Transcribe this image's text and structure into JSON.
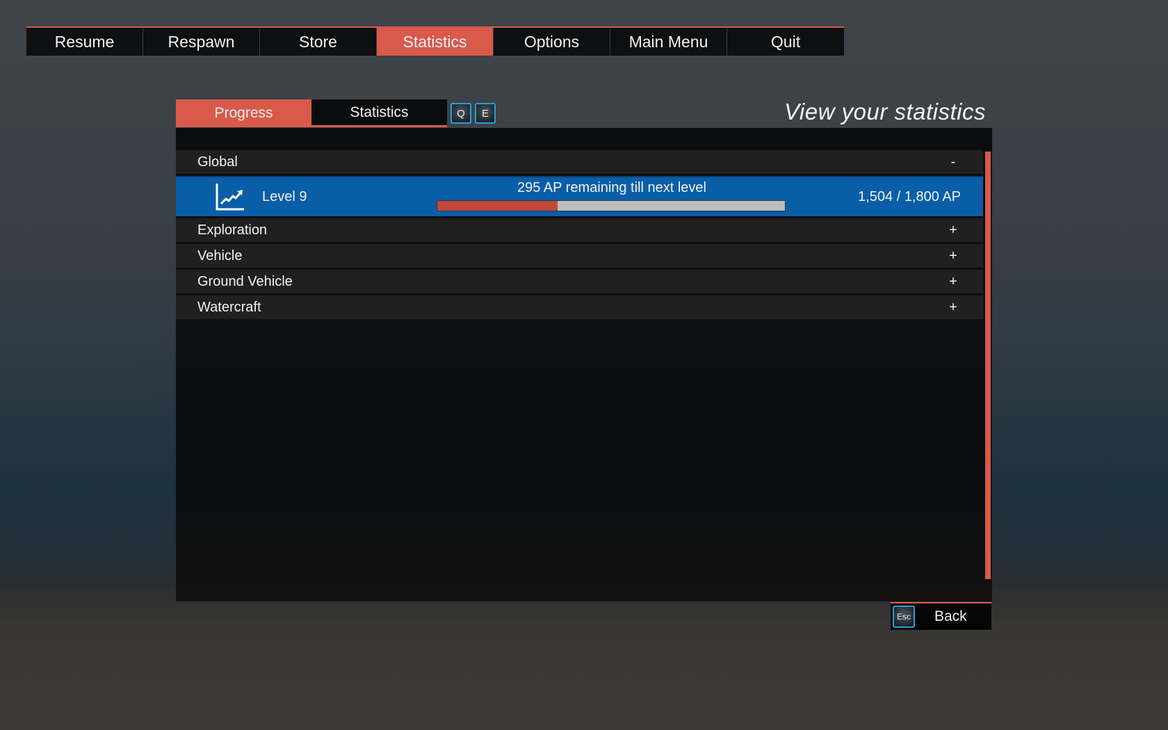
{
  "top_menu": {
    "items": [
      {
        "label": "Resume"
      },
      {
        "label": "Respawn"
      },
      {
        "label": "Store"
      },
      {
        "label": "Statistics",
        "active": true
      },
      {
        "label": "Options"
      },
      {
        "label": "Main Menu"
      },
      {
        "label": "Quit"
      }
    ]
  },
  "sub_tabs": {
    "items": [
      {
        "label": "Progress",
        "active": true
      },
      {
        "label": "Statistics",
        "active": false
      }
    ],
    "prev_key": "Q",
    "next_key": "E"
  },
  "page_heading": "View your statistics",
  "categories": [
    {
      "label": "Global",
      "toggle": "-",
      "expanded": true
    },
    {
      "label": "Exploration",
      "toggle": "+",
      "expanded": false
    },
    {
      "label": "Vehicle",
      "toggle": "+",
      "expanded": false
    },
    {
      "label": "Ground Vehicle",
      "toggle": "+",
      "expanded": false
    },
    {
      "label": "Watercraft",
      "toggle": "+",
      "expanded": false
    }
  ],
  "level": {
    "icon": "chart-trending-up-icon",
    "label": "Level 9",
    "remaining_text": "295 AP remaining till next level",
    "ap_text": "1,504 / 1,800 AP",
    "progress_fraction": 0.345
  },
  "back": {
    "key": "Esc",
    "label": "Back"
  },
  "colors": {
    "accent": "#d9594a",
    "highlight_row": "#0a5ea8",
    "key_border": "#2a9fd6",
    "progress_fill": "#c0493a",
    "progress_track": "#bdbdbd"
  }
}
